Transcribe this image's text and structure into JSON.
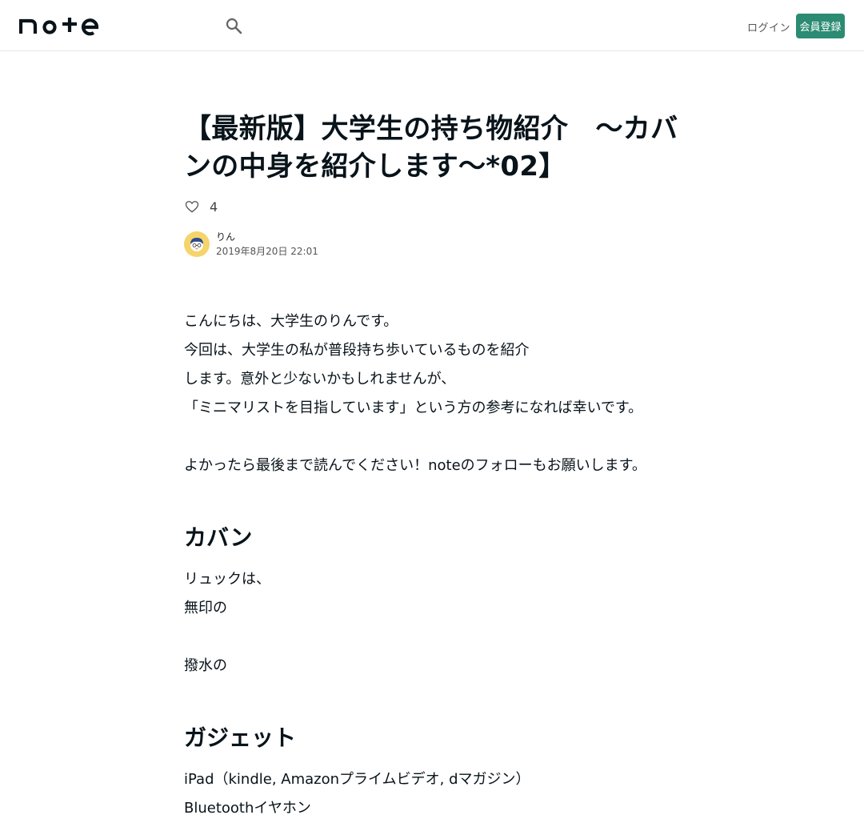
{
  "header": {
    "logo_text": "note",
    "search_icon": "search-icon",
    "login_label": "ログイン",
    "signup_label": "会員登録",
    "accent_color": "#2b8b73"
  },
  "article": {
    "title": "【最新版】大学生の持ち物紹介　〜カバンの中身を紹介します〜*02】",
    "likes": "4",
    "author_name": "りん",
    "date": "2019年8月20日 22:01",
    "intro": [
      "こんにちは、大学生のりんです。",
      "今回は、大学生の私が普段持ち歩いているものを紹介",
      "します。意外と少ないかもしれませんが、",
      "「ミニマリストを目指しています」という方の参考になれば幸いです。",
      "",
      "よかったら最後まで読んでください！noteのフォローもお願いします。"
    ],
    "section1_title": "カバン",
    "section1_lines": [
      "リュックは、",
      "無印の",
      "",
      "撥水の"
    ],
    "section2_title": "ガジェット",
    "section2_lines": [
      "iPad（kindle, Amazonプライムビデオ, dマガジン）",
      "Bluetoothイヤホン"
    ]
  }
}
